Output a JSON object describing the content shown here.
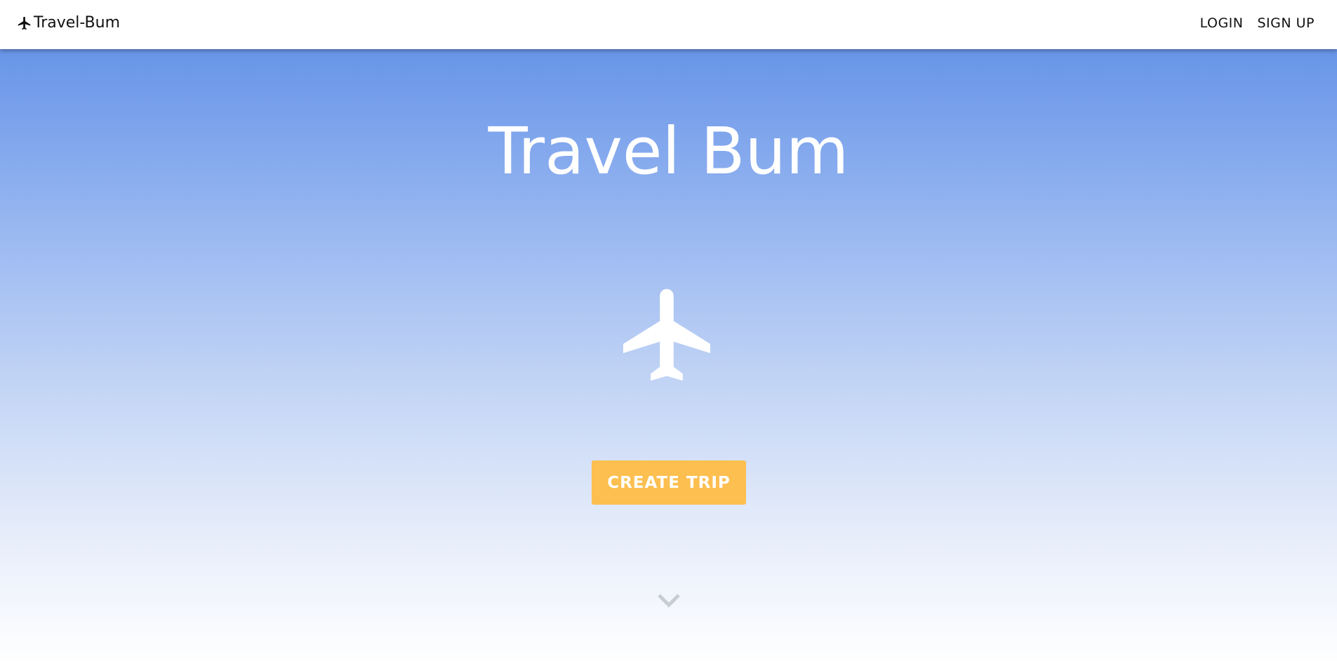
{
  "navbar": {
    "brand_label": "Travel-Bum",
    "brand_icon": "airplane-icon",
    "links": [
      {
        "label": "LOGIN"
      },
      {
        "label": "SIGN UP"
      }
    ]
  },
  "hero": {
    "title": "Travel Bum",
    "icon": "airplane-icon",
    "cta_label": "CREATE TRIP",
    "scroll_icon": "chevron-down-icon"
  },
  "colors": {
    "hero_top": "#6895e8",
    "hero_bottom": "#ffffff",
    "cta_background": "#fdbf50",
    "text_on_hero": "#ffffff"
  }
}
